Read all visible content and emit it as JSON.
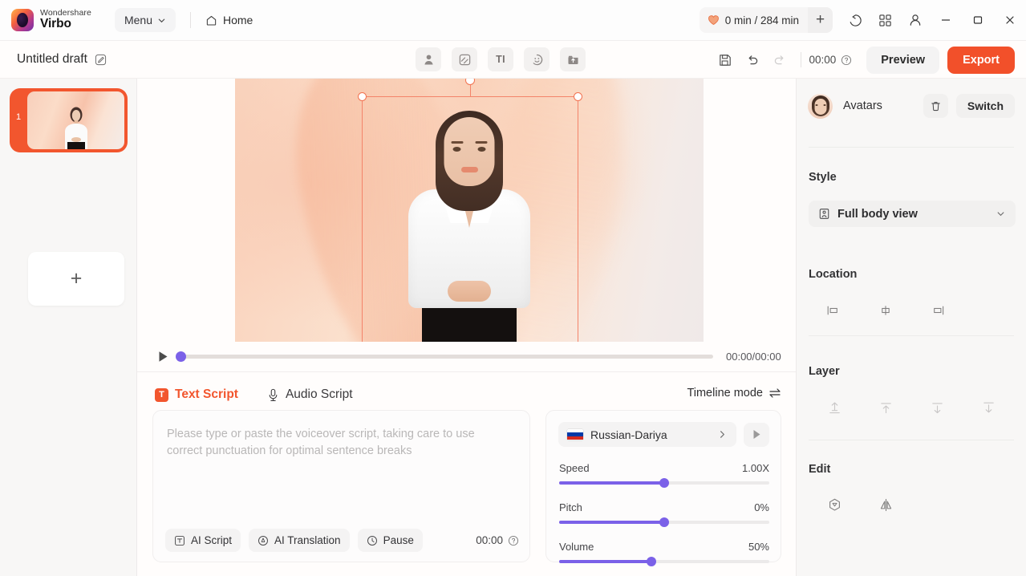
{
  "app": {
    "brand_top": "Wondershare",
    "brand_bottom": "Virbo",
    "menu_label": "Menu",
    "home_label": "Home",
    "credits_text": "0 min / 284 min",
    "accent_orange": "#f2562e",
    "accent_purple": "#7b61e8"
  },
  "subbar": {
    "draft_title": "Untitled draft",
    "center_tools": [
      {
        "name": "avatar-tool",
        "label": ""
      },
      {
        "name": "background-tool",
        "label": ""
      },
      {
        "name": "text-tool",
        "label": "TI"
      },
      {
        "name": "sticker-tool",
        "label": ""
      },
      {
        "name": "upload-tool",
        "label": ""
      }
    ],
    "timecode": "00:00",
    "preview_label": "Preview",
    "export_label": "Export"
  },
  "rail": {
    "slide_number": "1",
    "add_label": "+"
  },
  "player": {
    "current_total": "00:00/00:00",
    "progress_percent": 0
  },
  "script": {
    "tab_text": "Text Script",
    "tab_text_icon_letter": "T",
    "tab_audio": "Audio Script",
    "timeline_mode": "Timeline mode",
    "placeholder": "Please type or paste the voiceover script, taking care to use correct punctuation for optimal sentence breaks",
    "value": "",
    "actions": [
      {
        "name": "ai-script-button",
        "label": "AI Script"
      },
      {
        "name": "ai-translation-button",
        "label": "AI Translation"
      },
      {
        "name": "pause-button",
        "label": "Pause"
      }
    ],
    "duration": "00:00"
  },
  "voice": {
    "name": "Russian-Dariya",
    "flag_colors": [
      "#ffffff",
      "#0039a6",
      "#d52b1e"
    ],
    "sliders": [
      {
        "name": "speed",
        "label": "Speed",
        "value": "1.00X",
        "fill_percent": 50
      },
      {
        "name": "pitch",
        "label": "Pitch",
        "value": "0%",
        "fill_percent": 50
      },
      {
        "name": "volume",
        "label": "Volume",
        "value": "50%",
        "fill_percent": 44
      }
    ]
  },
  "right_panel": {
    "title": "Avatars",
    "switch_label": "Switch",
    "style_section": "Style",
    "style_value": "Full body view",
    "location_section": "Location",
    "location_icons": [
      "align-left-icon",
      "align-center-icon",
      "align-right-icon"
    ],
    "layer_section": "Layer",
    "layer_icons": [
      "bring-to-front-icon",
      "bring-forward-icon",
      "send-backward-icon",
      "send-to-back-icon"
    ],
    "edit_section": "Edit",
    "edit_icons": [
      "mask-icon",
      "flip-horizontal-icon"
    ]
  }
}
